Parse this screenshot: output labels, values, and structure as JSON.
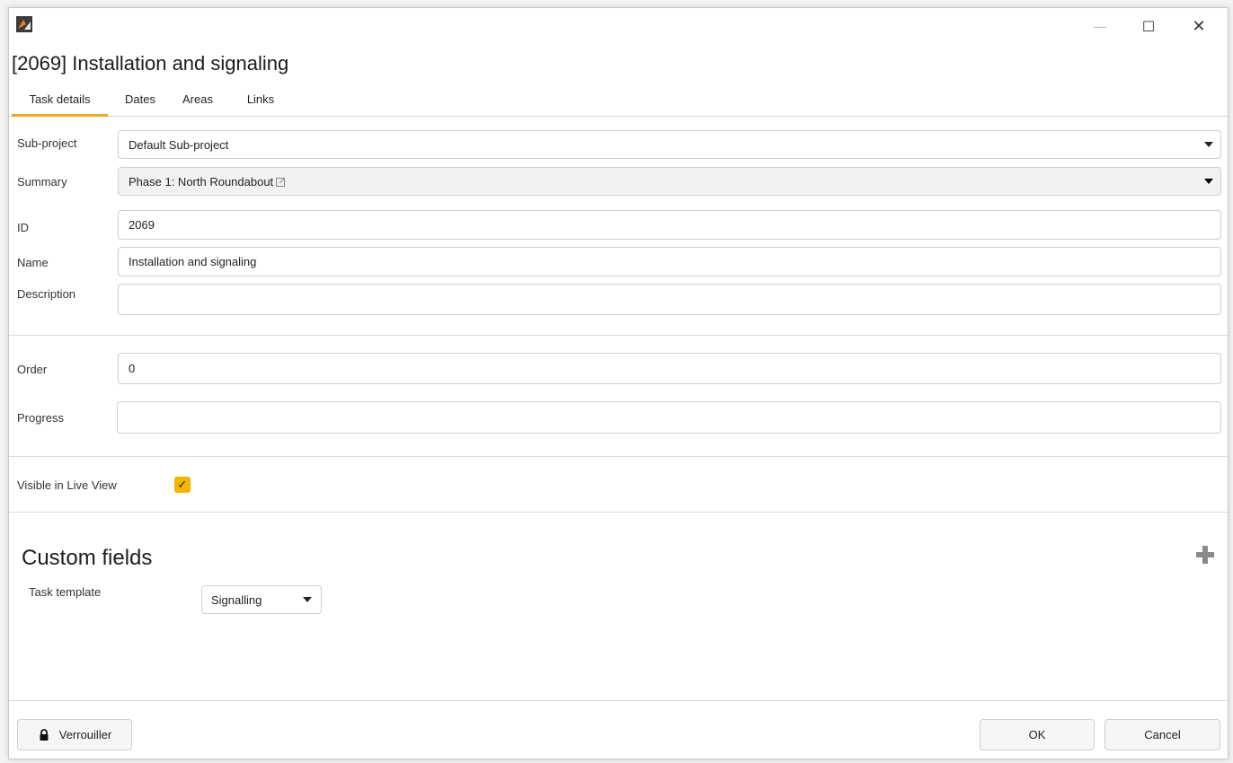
{
  "window": {
    "min_glyph": "—",
    "max_glyph": "☐",
    "close_glyph": "✕"
  },
  "dialog": {
    "title": "[2069] Installation and signaling"
  },
  "tabs": [
    {
      "label": "Task details",
      "active": true
    },
    {
      "label": "Dates",
      "active": false
    },
    {
      "label": "Areas",
      "active": false
    },
    {
      "label": "Links",
      "active": false
    }
  ],
  "form": {
    "subproject": {
      "label": "Sub-project",
      "value": "Default Sub-project"
    },
    "summary": {
      "label": "Summary",
      "value": "Phase 1: North Roundabout"
    },
    "id": {
      "label": "ID",
      "value": "2069"
    },
    "name": {
      "label": "Name",
      "value": "Installation and signaling"
    },
    "description": {
      "label": "Description",
      "value": ""
    },
    "order": {
      "label": "Order",
      "value": "0"
    },
    "progress": {
      "label": "Progress",
      "value": ""
    },
    "visible_live": {
      "label": "Visible in Live View",
      "checked": true
    }
  },
  "custom_fields": {
    "title": "Custom fields",
    "task_template": {
      "label": "Task template",
      "value": "Signalling"
    }
  },
  "footer": {
    "lock_label": "Verrouiller",
    "ok_label": "OK",
    "cancel_label": "Cancel"
  },
  "colors": {
    "accent": "#f0a81c",
    "checkbox": "#f4b400"
  }
}
